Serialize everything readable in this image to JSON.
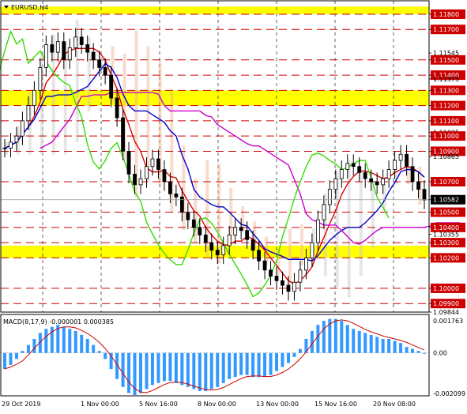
{
  "title": "EURUSD,H4",
  "colors": {
    "zone": "#ffff00",
    "level_line": "#cc0000",
    "candle": "#000000",
    "tenkan": "#dd0000",
    "kijun": "#0000cc",
    "senkou_b": "#cc00cc",
    "chikou": "#33dd00",
    "cloud_up": "#f0b090",
    "cloud_down": "#c8c8c8",
    "macd_hist": "#3399ff",
    "macd_signal": "#cc0000",
    "current_price_bg": "#000000"
  },
  "price_axis": {
    "min": 1.09844,
    "max": 1.11888,
    "labels": [
      "1.11800",
      "1.11700",
      "1.11545",
      "1.11500",
      "1.11400",
      "1.11375",
      "1.11300",
      "1.11200",
      "1.11100",
      "1.11025",
      "1.11000",
      "1.10900",
      "1.10865",
      "1.10700",
      "1.10582",
      "1.10500",
      "1.10400",
      "1.10355",
      "1.10300",
      "1.10200",
      "1.10000",
      "1.09900",
      "1.09844"
    ],
    "highlighted_labels": [
      "1.11800",
      "1.11700",
      "1.11500",
      "1.11400",
      "1.11300",
      "1.11200",
      "1.11100",
      "1.11000",
      "1.10900",
      "1.10700",
      "1.10500",
      "1.10400",
      "1.10300",
      "1.10200",
      "1.10000",
      "1.09900"
    ],
    "current_price": "1.10582"
  },
  "zones": [
    {
      "from": 1.118,
      "to": 1.1185
    },
    {
      "from": 1.112,
      "to": 1.113
    },
    {
      "from": 1.102,
      "to": 1.1028
    }
  ],
  "levels": [
    "1.11800",
    "1.11700",
    "1.11500",
    "1.11400",
    "1.11300",
    "1.11200",
    "1.11100",
    "1.11000",
    "1.10900",
    "1.10700",
    "1.10500",
    "1.10400",
    "1.10300",
    "1.10200",
    "1.10000",
    "1.09900"
  ],
  "time_axis": [
    "29 Oct 2019",
    "1 Nov 00:00",
    "5 Nov 16:00",
    "8 Nov 00:00",
    "13 Nov 00:00",
    "15 Nov 16:00",
    "20 Nov 08:00"
  ],
  "macd": {
    "label": "MACD(8,17,9) -0.000001 0.000385",
    "axis_labels": [
      "0.001763",
      "0.00",
      "-0.002099"
    ],
    "min": -0.002099,
    "max": 0.001763
  },
  "chart_data": {
    "type": "candlestick",
    "symbol": "EURUSD",
    "timeframe": "H4",
    "close": [
      1.1092,
      1.1096,
      1.11,
      1.111,
      1.112,
      1.113,
      1.1145,
      1.116,
      1.1155,
      1.1162,
      1.115,
      1.1158,
      1.1165,
      1.116,
      1.1155,
      1.115,
      1.1145,
      1.114,
      1.1125,
      1.1112,
      1.109,
      1.1075,
      1.1068,
      1.1072,
      1.108,
      1.1085,
      1.1078,
      1.107,
      1.1062,
      1.106,
      1.105,
      1.1045,
      1.104,
      1.1035,
      1.103,
      1.1025,
      1.1022,
      1.1028,
      1.1035,
      1.104,
      1.1038,
      1.1032,
      1.1025,
      1.1018,
      1.1012,
      1.1008,
      1.1005,
      1.1002,
      1.0998,
      1.1004,
      1.1012,
      1.102,
      1.103,
      1.1045,
      1.1055,
      1.1065,
      1.1072,
      1.1078,
      1.1082,
      1.108,
      1.1076,
      1.1072,
      1.107,
      1.1068,
      1.1072,
      1.1078,
      1.1084,
      1.1088,
      1.108,
      1.107,
      1.1065,
      1.1058
    ],
    "macd_hist": [
      -0.0008,
      -0.0006,
      -0.0003,
      0.0001,
      0.0004,
      0.0007,
      0.001,
      0.0012,
      0.0013,
      0.0014,
      0.0013,
      0.0012,
      0.0011,
      0.0009,
      0.0007,
      0.0004,
      0.0001,
      -0.0003,
      -0.0008,
      -0.0013,
      -0.0017,
      -0.002,
      -0.0021,
      -0.002,
      -0.0018,
      -0.0016,
      -0.0015,
      -0.0014,
      -0.0014,
      -0.0015,
      -0.0016,
      -0.0017,
      -0.0018,
      -0.0019,
      -0.0019,
      -0.0018,
      -0.0017,
      -0.0015,
      -0.0013,
      -0.0012,
      -0.0011,
      -0.0011,
      -0.0012,
      -0.0012,
      -0.0012,
      -0.0011,
      -0.0009,
      -0.0007,
      -0.0005,
      -0.0002,
      0.0002,
      0.0007,
      0.0011,
      0.0014,
      0.0016,
      0.0017,
      0.0017,
      0.0016,
      0.0014,
      0.0012,
      0.0011,
      0.001,
      0.0009,
      0.0008,
      0.0007,
      0.0007,
      0.0006,
      0.0005,
      0.0003,
      0.0002,
      0.0001,
      0.0
    ]
  }
}
